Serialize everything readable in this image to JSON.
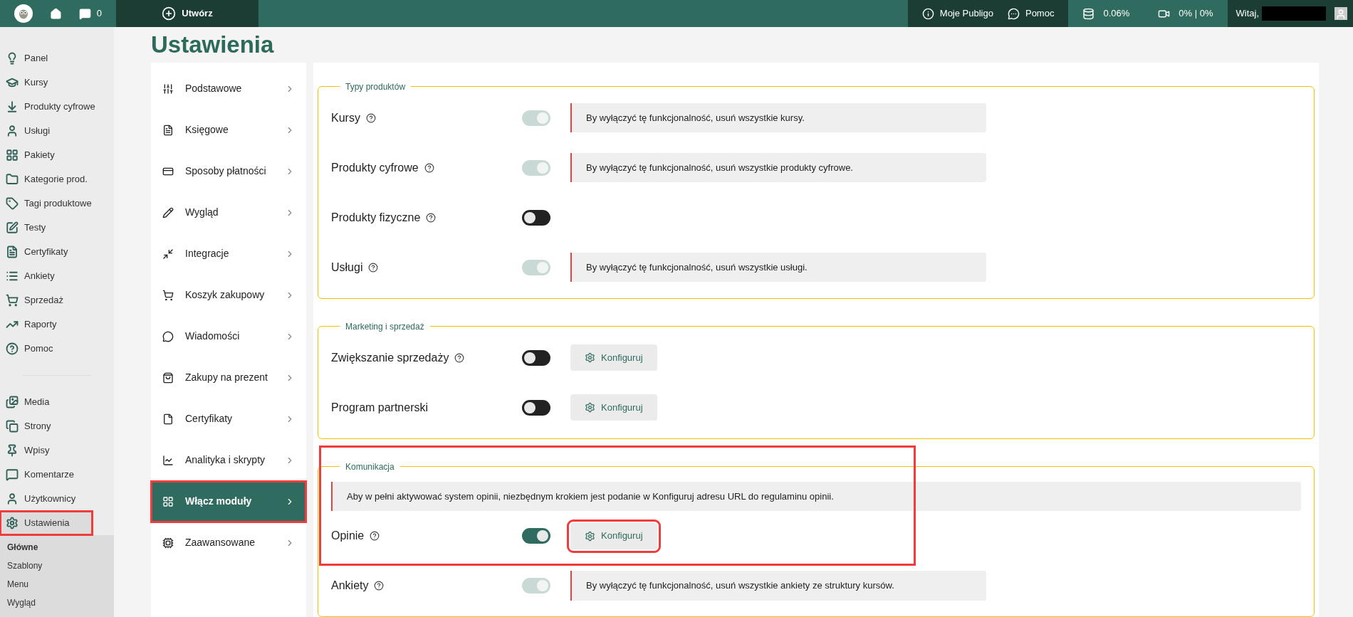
{
  "topbar": {
    "comments_count": "0",
    "create_label": "Utwórz",
    "links": [
      {
        "label": "Moje Publigo"
      },
      {
        "label": "Pomoc"
      }
    ],
    "storage": "0.06%",
    "video": "0% | 0%",
    "greeting": "Witaj,"
  },
  "sidebar": {
    "main_items": [
      {
        "label": "Panel",
        "selected": false,
        "highlighted": false
      },
      {
        "label": "Kursy",
        "selected": false,
        "highlighted": false
      },
      {
        "label": "Produkty cyfrowe",
        "selected": false,
        "highlighted": false
      },
      {
        "label": "Usługi",
        "selected": false,
        "highlighted": false
      },
      {
        "label": "Pakiety",
        "selected": false,
        "highlighted": false
      },
      {
        "label": "Kategorie prod.",
        "selected": false,
        "highlighted": false
      },
      {
        "label": "Tagi produktowe",
        "selected": false,
        "highlighted": false
      },
      {
        "label": "Testy",
        "selected": false,
        "highlighted": false
      },
      {
        "label": "Certyfikaty",
        "selected": false,
        "highlighted": false
      },
      {
        "label": "Ankiety",
        "selected": false,
        "highlighted": false
      },
      {
        "label": "Sprzedaż",
        "selected": false,
        "highlighted": false
      },
      {
        "label": "Raporty",
        "selected": false,
        "highlighted": false
      },
      {
        "label": "Pomoc",
        "selected": false,
        "highlighted": false
      }
    ],
    "site_items": [
      {
        "label": "Media",
        "selected": false,
        "highlighted": false
      },
      {
        "label": "Strony",
        "selected": false,
        "highlighted": false
      },
      {
        "label": "Wpisy",
        "selected": false,
        "highlighted": false
      },
      {
        "label": "Komentarze",
        "selected": false,
        "highlighted": false
      },
      {
        "label": "Użytkownicy",
        "selected": false,
        "highlighted": false
      },
      {
        "label": "Ustawienia",
        "selected": true,
        "highlighted": true
      }
    ],
    "submenu": [
      {
        "label": "Główne",
        "selected": true
      },
      {
        "label": "Szablony",
        "selected": false
      },
      {
        "label": "Menu",
        "selected": false
      },
      {
        "label": "Wygląd",
        "selected": false
      }
    ]
  },
  "page": {
    "title": "Ustawienia"
  },
  "settings_menu": [
    {
      "label": "Podstawowe",
      "selected": false,
      "highlighted": false
    },
    {
      "label": "Księgowe",
      "selected": false,
      "highlighted": false
    },
    {
      "label": "Sposoby płatności",
      "selected": false,
      "highlighted": false
    },
    {
      "label": "Wygląd",
      "selected": false,
      "highlighted": false
    },
    {
      "label": "Integracje",
      "selected": false,
      "highlighted": false
    },
    {
      "label": "Koszyk zakupowy",
      "selected": false,
      "highlighted": false
    },
    {
      "label": "Wiadomości",
      "selected": false,
      "highlighted": false
    },
    {
      "label": "Zakupy na prezent",
      "selected": false,
      "highlighted": false
    },
    {
      "label": "Certyfikaty",
      "selected": false,
      "highlighted": false
    },
    {
      "label": "Analityka i skrypty",
      "selected": false,
      "highlighted": false
    },
    {
      "label": "Włącz moduły",
      "selected": true,
      "highlighted": true
    },
    {
      "label": "Zaawansowane",
      "selected": false,
      "highlighted": false
    }
  ],
  "sections": [
    {
      "legend": "Typy produktów",
      "highlighted": false,
      "rows": [
        {
          "label": "Kursy",
          "help": true,
          "on": true,
          "disabled": true,
          "notice": "By wyłączyć tę funkcjonalność, usuń wszystkie kursy."
        },
        {
          "label": "Produkty cyfrowe",
          "help": true,
          "on": true,
          "disabled": true,
          "notice": "By wyłączyć tę funkcjonalność, usuń wszystkie produkty cyfrowe."
        },
        {
          "label": "Produkty fizyczne",
          "help": true,
          "on": false,
          "disabled": false
        },
        {
          "label": "Usługi",
          "help": true,
          "on": true,
          "disabled": true,
          "notice": "By wyłączyć tę funkcjonalność, usuń wszystkie usługi."
        }
      ]
    },
    {
      "legend": "Marketing i sprzedaż",
      "highlighted": false,
      "rows": [
        {
          "label": "Zwiększanie sprzedaży",
          "help": true,
          "on": false,
          "disabled": false,
          "configure": {
            "label": "Konfiguruj",
            "highlighted": false
          }
        },
        {
          "label": "Program partnerski",
          "help": false,
          "on": false,
          "disabled": false,
          "configure": {
            "label": "Konfiguruj",
            "highlighted": false
          }
        }
      ]
    },
    {
      "legend": "Komunikacja",
      "highlighted": true,
      "notice": "Aby w pełni aktywować system opinii, niezbędnym krokiem jest podanie w Konfiguruj adresu URL do regulaminu opinii.",
      "rows": [
        {
          "label": "Opinie",
          "help": true,
          "on": true,
          "disabled": false,
          "configure": {
            "label": "Konfiguruj",
            "highlighted": true
          }
        },
        {
          "label": "Ankiety",
          "help": true,
          "on": true,
          "disabled": true,
          "notice": "By wyłączyć tę funkcjonalność, usuń wszystkie ankiety ze struktury kursów."
        }
      ]
    }
  ]
}
